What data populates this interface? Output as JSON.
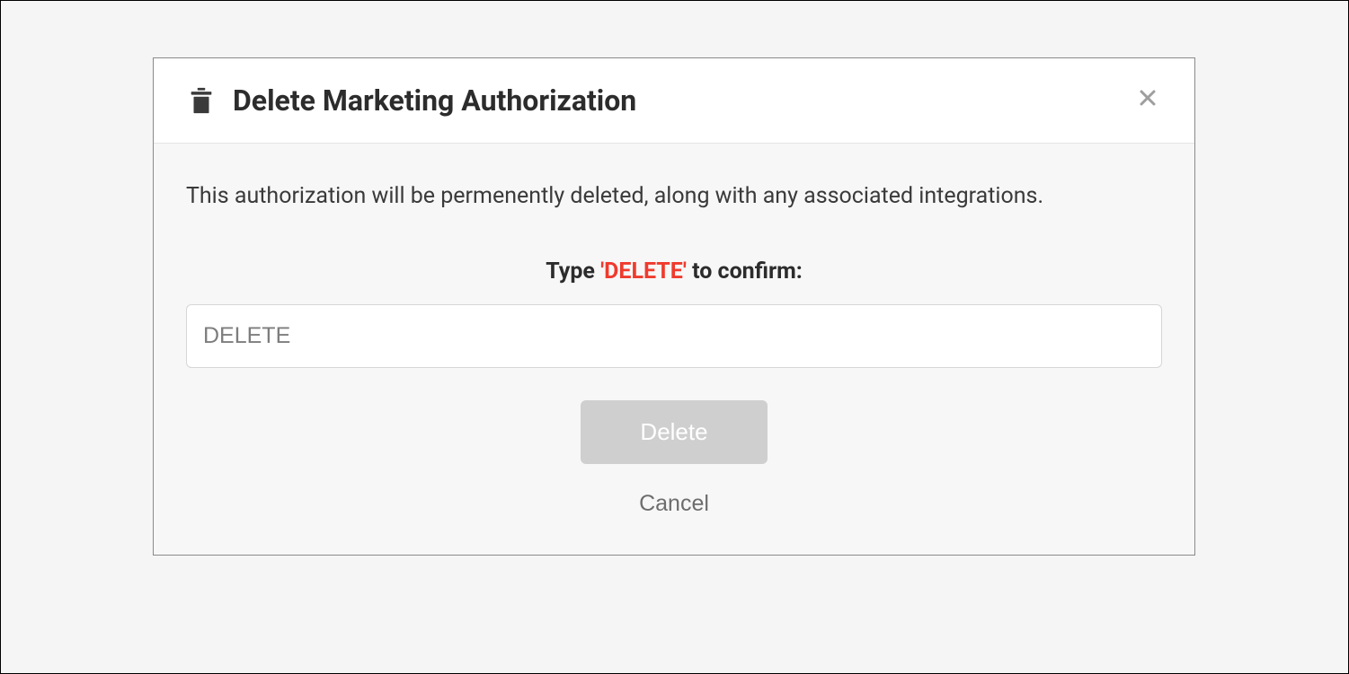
{
  "modal": {
    "title": "Delete Marketing Authorization",
    "warning": "This authorization will be permenently deleted, along with any associated integrations.",
    "confirm": {
      "prefix": "Type ",
      "keyword": "'DELETE'",
      "suffix": " to confirm:",
      "placeholder": "DELETE",
      "value": ""
    },
    "buttons": {
      "delete": "Delete",
      "cancel": "Cancel"
    }
  },
  "colors": {
    "danger": "#ef3b2d",
    "disabled_bg": "#cfcfcf"
  }
}
